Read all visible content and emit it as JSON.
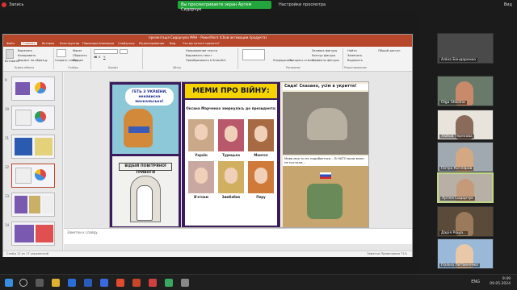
{
  "zoom_top": {
    "recording_label": "Запись",
    "share_notice": "Вы просматриваете экран Артем Сидорчук",
    "view_settings": "Настройки просмотра",
    "right_actions": "Вид"
  },
  "ppt": {
    "window_title": "презентація Сидорчука МАН - PowerPoint (Сбой активации продукта)",
    "menu": [
      "Файл",
      "Главная",
      "Вставка",
      "Конструктор",
      "Переходы",
      "Анимация",
      "Слайд-шоу",
      "Рецензирование",
      "Вид",
      "Что вы хотите сделать?"
    ],
    "ribbon": {
      "paste": "Вставить",
      "cut": "Вырезать",
      "copy": "Копировать",
      "format_painter": "Формат по образцу",
      "clipboard_group": "Буфер обмена",
      "layout": "Макет",
      "reset": "Сбросить",
      "section": "Раздел",
      "slides_group": "Слайды",
      "new_slide": "Создать слайд",
      "font_group": "Шрифт",
      "paragraph_group": "Абзац",
      "arrange": "Упорядочить",
      "quick_styles": "Экспресс-стили",
      "drawing_group": "Рисование",
      "shape_fill": "Заливка фигуры",
      "shape_outline": "Контур фигуры",
      "shape_effects": "Эффекты фигуры",
      "find": "Найти",
      "replace": "Заменить",
      "select": "Выделить",
      "editing_group": "Редактирование",
      "text_direction": "Направление текста",
      "align_text": "Выровнять текст",
      "smartart": "Преобразовать в SmartArt",
      "share": "Общий доступ"
    },
    "slide_numbers": [
      "9",
      "10",
      "11",
      "12",
      "13",
      "14"
    ],
    "notes_placeholder": "Заметки к слайду",
    "status_left": "Слайд 12 из 17    украинский",
    "status_right": "Заметки    Примечания    71%"
  },
  "slide": {
    "left_top_caption": "ГЕТЬ З УКРАЇНИ, ненависна москальська!",
    "left_bottom_caption": "ВІДБІЙ ПОВІТРЯНОЇ ТРИВОГИ",
    "title": "МЕМИ ПРО ВІЙНУ:",
    "subtitle": "Оксана Марченко звернулась до президента:",
    "portraits": [
      "Україн",
      "Турецька",
      "Монгол",
      "В'єтнам",
      "Зимбабве",
      "Перу"
    ],
    "right_top_caption": "Сидя! Сказано, усім в укриття!",
    "right_mid_caption": "Мова моя ти не подобається... В НАТО вони мене не пустили..."
  },
  "participants": [
    {
      "name": "Аліна Бондаренко"
    },
    {
      "name": "Olga Shkolna"
    },
    {
      "name": "Любов Терехова"
    },
    {
      "name": "Петро Котляров"
    },
    {
      "name": "Артем Сидорчук"
    },
    {
      "name": "Дарія Роща..."
    },
    {
      "name": "Поліна Литвиненко"
    }
  ],
  "taskbar": {
    "lang": "ENG",
    "time": "9:49",
    "date": "09.05.2024"
  }
}
